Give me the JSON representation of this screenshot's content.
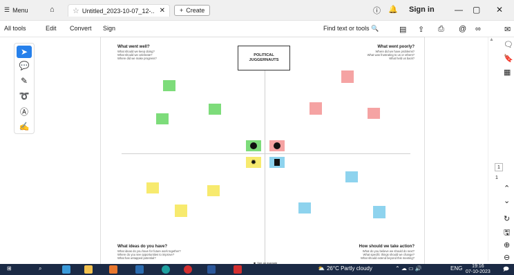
{
  "titlebar": {
    "menu": "Menu",
    "tab_title": "Untitled_2023-10-07_12-..",
    "create": "Create",
    "sign_in": "Sign in"
  },
  "toolbar": {
    "items": [
      "All tools",
      "Edit",
      "Convert",
      "Sign"
    ],
    "find": "Find text or tools"
  },
  "page": {
    "center_title": "POLITICAL\nJUGGERNAUTS",
    "q1_title": "What went well?",
    "q1_lines": [
      "What should we keep doing?",
      "What should we celebrate?",
      "Where did we make progress?"
    ],
    "q2_title": "What went poorly?",
    "q2_lines": [
      "Where did we have problems?",
      "What was frustrating to us or others?",
      "What held us back?"
    ],
    "q3_title": "What ideas do you have?",
    "q3_lines": [
      "What ideas do you have for future work together?",
      "Where do you see opportunities to improve?",
      "What has untapped potential?"
    ],
    "q4_title": "How should we take action?",
    "q4_lines": [
      "What do you believe we should do next?",
      "What specific things should we change?",
      "What should extend beyond this meeting?"
    ],
    "footer": "See an example"
  },
  "pagination": {
    "current": "1",
    "total": "1"
  },
  "taskbar": {
    "weather": "26°C  Partly cloudy",
    "lang": "ENG",
    "time": "19:16",
    "date": "07-10-2023"
  },
  "colors": {
    "accent": "#2680eb",
    "green": "#7ddc7a",
    "pink": "#f5a3a3",
    "yellow": "#f7ea6e",
    "blue": "#8ed3ee"
  }
}
